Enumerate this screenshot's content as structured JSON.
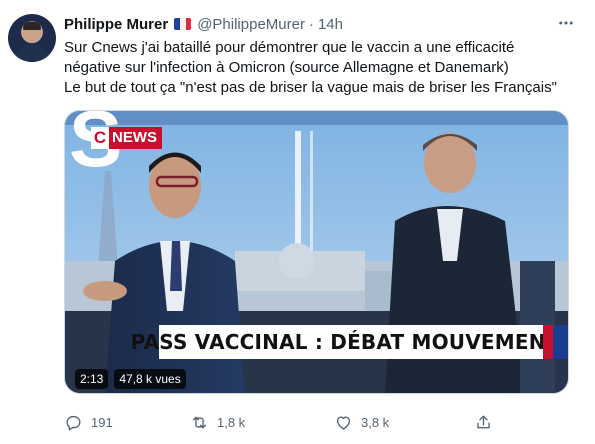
{
  "author": {
    "name": "Philippe Murer",
    "flag": "french-flag-icon",
    "handle": "@PhilippeMurer",
    "separator": "·",
    "time": "14h"
  },
  "tweet": {
    "lines": [
      "Sur Cnews j'ai bataillé pour démontrer que le vaccin a une efficacité",
      "négative sur l'infection à Omicron (source Allemagne et Danemark)",
      "Le but de tout ça \"n'est pas de briser la vague mais de briser les Français\""
    ]
  },
  "media": {
    "channel_logo": "NEWS",
    "channel_letter": "C",
    "logo_s": "S",
    "banner": "PASS VACCINAL : DÉBAT MOUVEMENTÉ",
    "duration": "2:13",
    "views": "47,8 k vues"
  },
  "actions": {
    "reply_count": "191",
    "retweet_count": "1,8 k",
    "like_count": "3,8 k"
  },
  "colors": {
    "brand_red": "#c8102e",
    "text_muted": "#536471"
  }
}
